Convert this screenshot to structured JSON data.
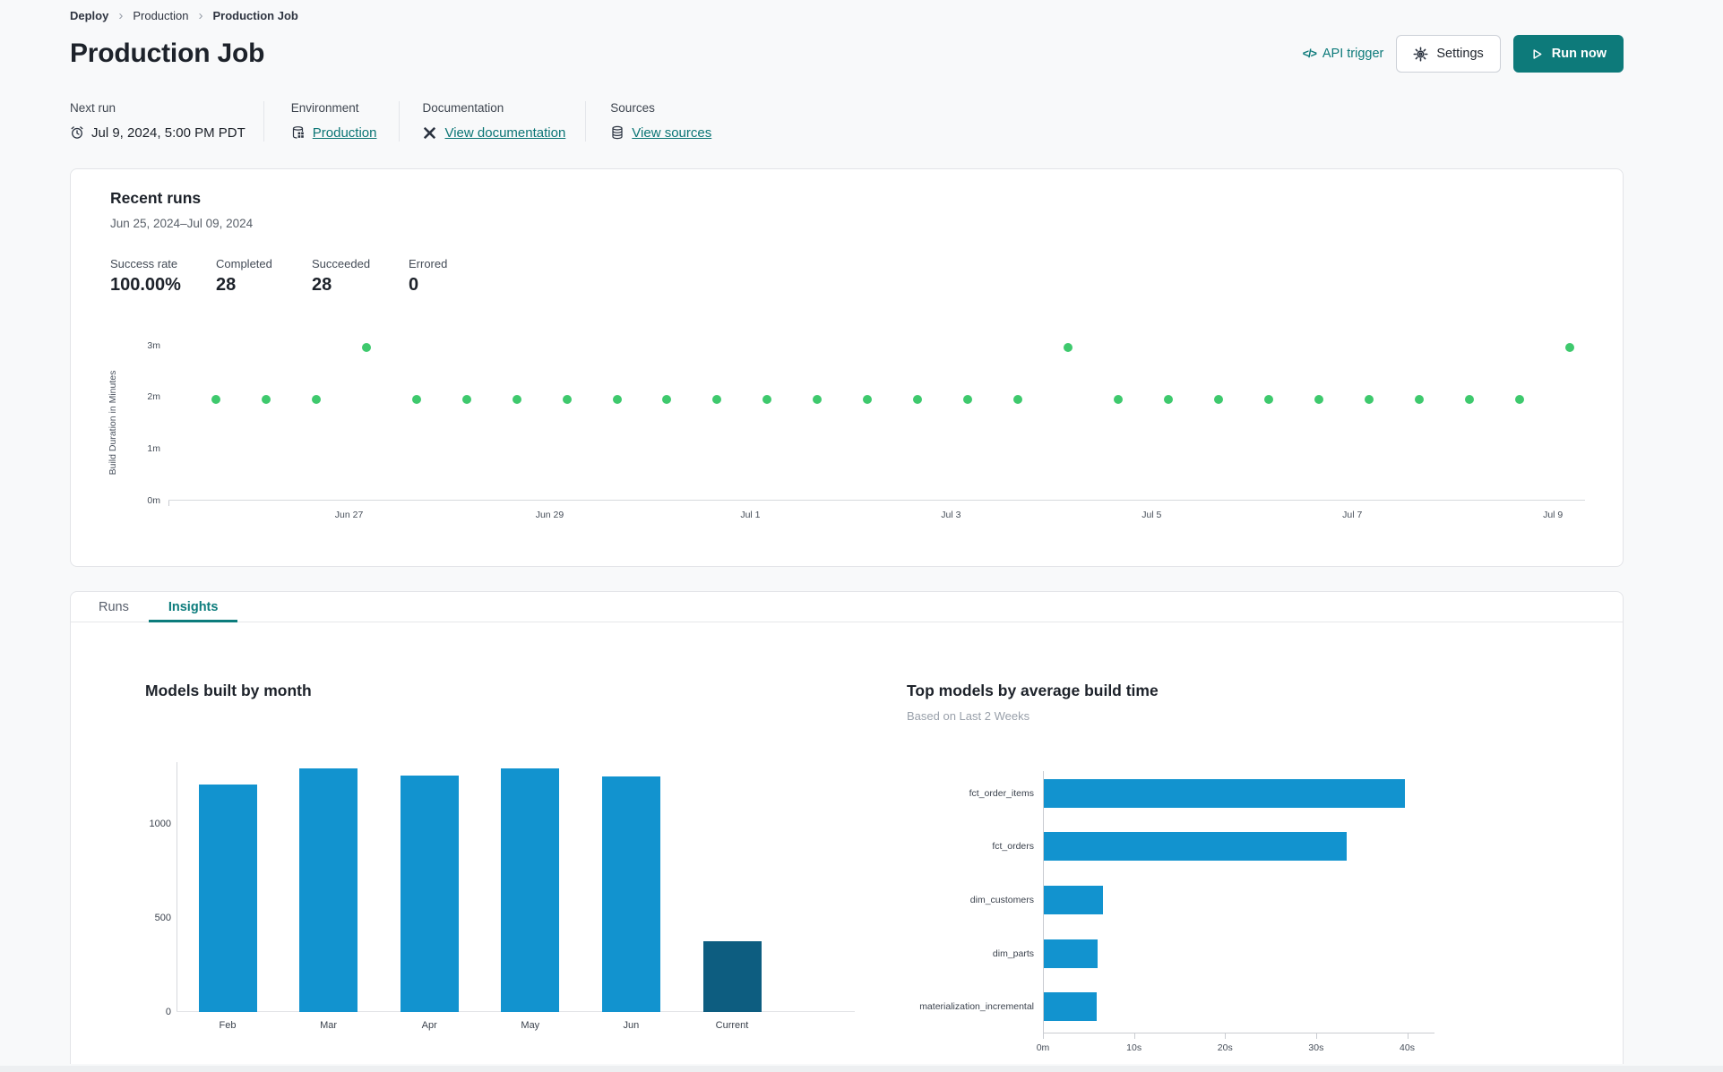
{
  "breadcrumb": {
    "separator": "›",
    "items": [
      "Deploy",
      "Production",
      "Production Job"
    ]
  },
  "header": {
    "title": "Production Job",
    "actions": {
      "api_icon": "</>",
      "api_trigger": "API trigger",
      "settings": "Settings",
      "run_now": "Run now"
    }
  },
  "info_row": {
    "next_run": {
      "label": "Next run",
      "value": "Jul 9, 2024, 5:00 PM PDT"
    },
    "environment": {
      "label": "Environment",
      "value": "Production"
    },
    "documentation": {
      "label": "Documentation",
      "value": "View documentation"
    },
    "sources": {
      "label": "Sources",
      "value": "View sources"
    }
  },
  "recent_runs": {
    "title": "Recent runs",
    "date_range": "Jun 25, 2024–Jul 09, 2024",
    "stats": [
      {
        "label": "Success rate",
        "value": "100.00%"
      },
      {
        "label": "Completed",
        "value": "28"
      },
      {
        "label": "Succeeded",
        "value": "28"
      },
      {
        "label": "Errored",
        "value": "0"
      }
    ]
  },
  "tabs": [
    {
      "label": "Runs",
      "active": false
    },
    {
      "label": "Insights",
      "active": true
    }
  ],
  "colors": {
    "teal": "#0d7a7a",
    "link_teal": "#0b7575",
    "dot_green": "#3ec96d",
    "bar_blue": "#1293cf",
    "bar_dark_blue": "#0d5d80"
  },
  "chart_data": [
    {
      "type": "scatter",
      "name": "build-duration-by-run",
      "ylabel": "Build Duration in Minutes",
      "ylim": [
        0,
        3.2
      ],
      "yticks": [
        {
          "value": 0,
          "label": "0m"
        },
        {
          "value": 1,
          "label": "1m"
        },
        {
          "value": 2,
          "label": "2m"
        },
        {
          "value": 3,
          "label": "3m"
        }
      ],
      "xlim_days": [
        0.2,
        14.32
      ],
      "xticks": [
        {
          "day": 2,
          "label": "Jun 27"
        },
        {
          "day": 4,
          "label": "Jun 29"
        },
        {
          "day": 6,
          "label": "Jul 1"
        },
        {
          "day": 8,
          "label": "Jul 3"
        },
        {
          "day": 10,
          "label": "Jul 5"
        },
        {
          "day": 12,
          "label": "Jul 7"
        },
        {
          "day": 14,
          "label": "Jul 9"
        }
      ],
      "point_color": "#3ec96d",
      "points": [
        {
          "day": 0.67,
          "minutes": 1.95
        },
        {
          "day": 1.17,
          "minutes": 1.95
        },
        {
          "day": 1.67,
          "minutes": 1.95
        },
        {
          "day": 2.17,
          "minutes": 2.95
        },
        {
          "day": 2.67,
          "minutes": 1.95
        },
        {
          "day": 3.17,
          "minutes": 1.95
        },
        {
          "day": 3.67,
          "minutes": 1.95
        },
        {
          "day": 4.17,
          "minutes": 1.95
        },
        {
          "day": 4.67,
          "minutes": 1.95
        },
        {
          "day": 5.17,
          "minutes": 1.95
        },
        {
          "day": 5.67,
          "minutes": 1.95
        },
        {
          "day": 6.17,
          "minutes": 1.95
        },
        {
          "day": 6.67,
          "minutes": 1.95
        },
        {
          "day": 7.17,
          "minutes": 1.95
        },
        {
          "day": 7.67,
          "minutes": 1.95
        },
        {
          "day": 8.17,
          "minutes": 1.95
        },
        {
          "day": 8.67,
          "minutes": 1.95
        },
        {
          "day": 9.17,
          "minutes": 2.95
        },
        {
          "day": 9.67,
          "minutes": 1.95
        },
        {
          "day": 10.17,
          "minutes": 1.95
        },
        {
          "day": 10.67,
          "minutes": 1.95
        },
        {
          "day": 11.17,
          "minutes": 1.95
        },
        {
          "day": 11.67,
          "minutes": 1.95
        },
        {
          "day": 12.17,
          "minutes": 1.95
        },
        {
          "day": 12.67,
          "minutes": 1.95
        },
        {
          "day": 13.17,
          "minutes": 1.95
        },
        {
          "day": 13.67,
          "minutes": 1.95
        },
        {
          "day": 14.17,
          "minutes": 2.95
        }
      ]
    },
    {
      "type": "bar",
      "name": "models-built-by-month",
      "title": "Models built by month",
      "categories": [
        "Feb",
        "Mar",
        "Apr",
        "May",
        "Jun",
        "Current"
      ],
      "values": [
        1210,
        1295,
        1260,
        1295,
        1255,
        375
      ],
      "ylim": [
        0,
        1330
      ],
      "yticks": [
        0,
        500,
        1000
      ],
      "bar_color": "#1293cf",
      "highlight_color": "#0d5d80",
      "highlight_index": 5
    },
    {
      "type": "horizontal-bar",
      "name": "top-models-by-average-build-time",
      "title": "Top models by average build time",
      "subtitle": "Based on Last 2 Weeks",
      "categories": [
        "fct_order_items",
        "fct_orders",
        "dim_customers",
        "dim_parts",
        "materialization_incremental"
      ],
      "values_seconds": [
        39.7,
        33.3,
        6.5,
        5.9,
        5.8
      ],
      "xlim": [
        0,
        43
      ],
      "xticks": [
        {
          "value": 0,
          "label": "0m"
        },
        {
          "value": 10,
          "label": "10s"
        },
        {
          "value": 20,
          "label": "20s"
        },
        {
          "value": 30,
          "label": "30s"
        },
        {
          "value": 40,
          "label": "40s"
        }
      ],
      "bar_color": "#1293cf"
    }
  ]
}
